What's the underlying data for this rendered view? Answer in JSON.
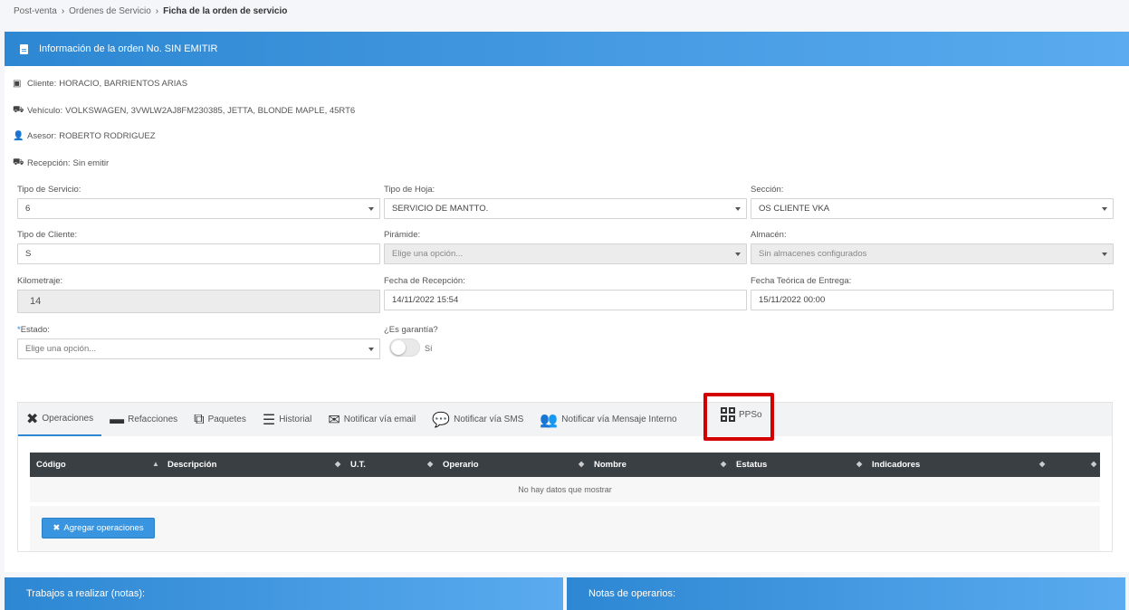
{
  "breadcrumb": {
    "items": [
      "Post-venta",
      "Ordenes de Servicio"
    ],
    "current": "Ficha de la orden de servicio"
  },
  "header": {
    "title": "Información de la orden No. SIN EMITIR"
  },
  "info": {
    "cliente_label": "Cliente:",
    "cliente_value": "HORACIO, BARRIENTOS ARIAS",
    "vehiculo_label": "Vehículo:",
    "vehiculo_value": "VOLKSWAGEN, 3VWLW2AJ8FM230385, JETTA, BLONDE MAPLE, 45RT6",
    "asesor_label": "Asesor:",
    "asesor_value": "ROBERTO RODRIGUEZ",
    "recepcion_label": "Recepción:",
    "recepcion_value": "Sin emitir"
  },
  "form": {
    "tipo_servicio_label": "Tipo de Servicio:",
    "tipo_servicio_value": "6",
    "tipo_hoja_label": "Tipo de Hoja:",
    "tipo_hoja_value": "SERVICIO DE MANTTO.",
    "seccion_label": "Sección:",
    "seccion_value": "OS CLIENTE VKA",
    "tipo_cliente_label": "Tipo de Cliente:",
    "tipo_cliente_value": "S",
    "piramide_label": "Pirámide:",
    "piramide_value": "Elige una opción...",
    "almacen_label": "Almacén:",
    "almacen_value": "Sin almacenes configurados",
    "kilometraje_label": "Kilometraje:",
    "kilometraje_value": "14",
    "fecha_recepcion_label": "Fecha de Recepción:",
    "fecha_recepcion_value": "14/11/2022 15:54",
    "fecha_entrega_label": "Fecha Teórica de Entrega:",
    "fecha_entrega_value": "15/11/2022 00:00",
    "estado_required": "*",
    "estado_label": "Estado:",
    "estado_value": "Elige una opción...",
    "garantia_label": "¿Es garantía?",
    "garantia_toggle_label": "Sí"
  },
  "tabs": [
    {
      "label": "Operaciones",
      "icon": "tools-icon"
    },
    {
      "label": "Refacciones",
      "icon": "battery-icon"
    },
    {
      "label": "Paquetes",
      "icon": "cubes-icon"
    },
    {
      "label": "Historial",
      "icon": "list-icon"
    },
    {
      "label": "Notificar vía email",
      "icon": "envelope-icon"
    },
    {
      "label": "Notificar vía SMS",
      "icon": "comments-icon"
    },
    {
      "label": "Notificar vía Mensaje Interno",
      "icon": "users-icon"
    },
    {
      "label": "PPSo",
      "icon": "qrcode-icon"
    }
  ],
  "table": {
    "columns": [
      "Código",
      "Descripción",
      "U.T.",
      "Operario",
      "Nombre",
      "Estatus",
      "Indicadores"
    ],
    "empty_text": "No hay datos que mostrar"
  },
  "add_button": "Agregar operaciones",
  "bottom": {
    "left_title": "Trabajos a realizar (notas):",
    "right_title": "Notas de operarios:"
  },
  "colors": {
    "header_blue": "#2d87d2",
    "highlight_red": "#d40000",
    "table_header": "#3a3f44"
  }
}
